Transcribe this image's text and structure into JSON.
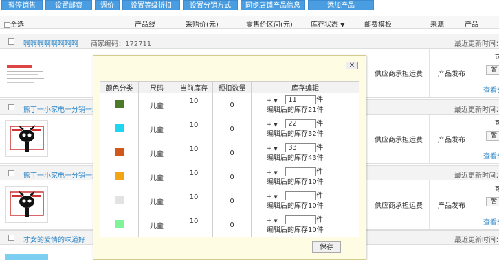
{
  "toolbar": {
    "buttons": [
      "暂停销售",
      "设置邮费",
      "调价",
      "设置等级折扣",
      "设置分销方式",
      "同步店铺产品信息",
      "添加产品"
    ]
  },
  "header": {
    "select_all": "全选",
    "cols": [
      "产品线",
      "采购价(元)",
      "零售价区间(元)",
      "库存状态",
      "邮费模板",
      "来源",
      "产品"
    ]
  },
  "products": [
    {
      "name": "啊啊啊啊啊啊啊啊",
      "code": "商家编码：172711",
      "updated": "最近更新时间：",
      "shipping": "供应商承担运费",
      "source": "产品发布",
      "btn": "暂",
      "link": "查看分",
      "top": "可"
    },
    {
      "name": "熊丁一小家电一分销一组合",
      "code": "",
      "updated": "最近更新时间：",
      "shipping": "供应商承担运费",
      "source": "产品发布",
      "btn": "暂",
      "link": "查看分",
      "top": "可"
    },
    {
      "name": "熊丁一小家电一分销一组合",
      "code": "",
      "updated": "最近更新时间：",
      "shipping": "供应商承担运费",
      "source": "产品发布",
      "btn": "暂",
      "link": "查看分",
      "top": "可"
    },
    {
      "name": "才女的爱情的味道好",
      "code": "",
      "updated": "最近更新时间：",
      "shipping": "",
      "source": "",
      "btn": "",
      "link": "",
      "top": ""
    }
  ],
  "modal": {
    "close": "✕",
    "cols": [
      "颜色分类",
      "尺码",
      "当前库存",
      "预扣数量",
      "库存编辑"
    ],
    "rows": [
      {
        "color": "#4d7a2a",
        "size": "儿童",
        "stock": "10",
        "reserved": "0",
        "op": "+",
        "qty": "11",
        "unit": "件",
        "after": "编辑后的库存21件"
      },
      {
        "color": "#1fd6f0",
        "size": "儿童",
        "stock": "10",
        "reserved": "0",
        "op": "+",
        "qty": "22",
        "unit": "件",
        "after": "编辑后的库存32件"
      },
      {
        "color": "#d2571a",
        "size": "儿童",
        "stock": "10",
        "reserved": "0",
        "op": "+",
        "qty": "33",
        "unit": "件",
        "after": "编辑后的库存43件"
      },
      {
        "color": "#f2a616",
        "size": "儿童",
        "stock": "10",
        "reserved": "0",
        "op": "+",
        "qty": "",
        "unit": "件",
        "after": "编辑后的库存10件"
      },
      {
        "color": "#e3e3e3",
        "size": "儿童",
        "stock": "10",
        "reserved": "0",
        "op": "+",
        "qty": "",
        "unit": "件",
        "after": "编辑后的库存10件"
      },
      {
        "color": "#7ff29a",
        "size": "儿童",
        "stock": "10",
        "reserved": "0",
        "op": "+",
        "qty": "",
        "unit": "件",
        "after": "编辑后的库存10件"
      }
    ],
    "save": "保存"
  }
}
